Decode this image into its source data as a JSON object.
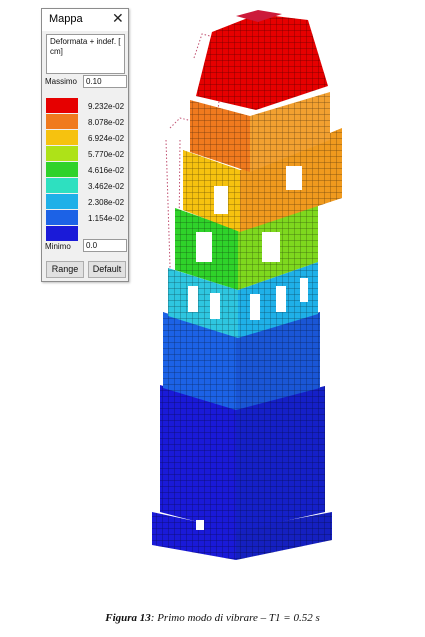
{
  "legend": {
    "title": "Mappa",
    "quantity": "Deformata + indef.  [ cm]",
    "max_label": "Massimo",
    "max_value": "0.10",
    "min_label": "Minimo",
    "min_value": "0.0",
    "scale": [
      {
        "color": "#e60000",
        "value": "9.232e-02"
      },
      {
        "color": "#f07a1e",
        "value": "8.078e-02"
      },
      {
        "color": "#f6c20f",
        "value": "6.924e-02"
      },
      {
        "color": "#aee218",
        "value": "5.770e-02"
      },
      {
        "color": "#2fd22a",
        "value": "4.616e-02"
      },
      {
        "color": "#2ee0c0",
        "value": "3.462e-02"
      },
      {
        "color": "#1fb0e8",
        "value": "2.308e-02"
      },
      {
        "color": "#1c62e6",
        "value": "1.154e-02"
      },
      {
        "color": "#1a1ad8",
        "value": ""
      }
    ],
    "range_button": "Range",
    "default_button": "Default"
  },
  "caption": {
    "label": "Figura 13",
    "text": ": Primo modo di vibrare – T1 = 0.52 s"
  }
}
